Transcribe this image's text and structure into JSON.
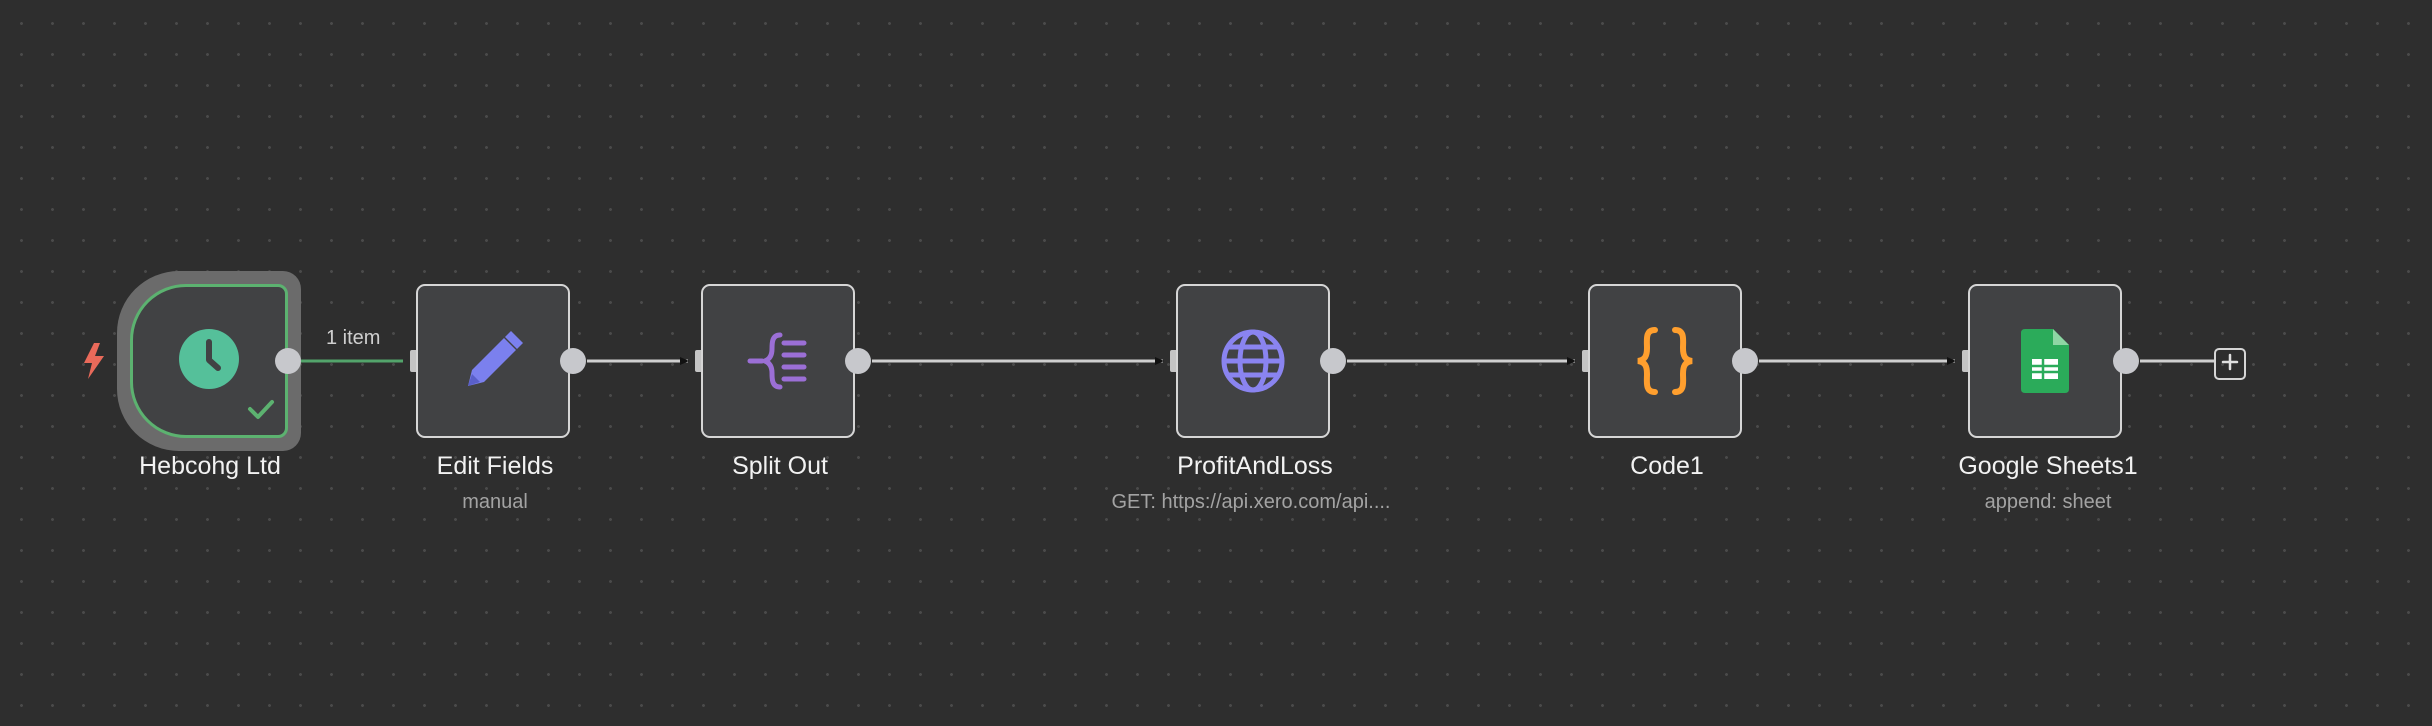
{
  "canvas": {
    "background": "#2e2e2e",
    "dot_color": "#4a4a4a"
  },
  "edge_label": "1 item",
  "nodes": [
    {
      "id": "trigger",
      "title": "Hebcohg Ltd",
      "icon": "clock-icon",
      "color": "#55c09a",
      "status": "success"
    },
    {
      "id": "edit",
      "title": "Edit Fields",
      "subtitle": "manual",
      "icon": "pencil-icon",
      "color": "#7b80ee"
    },
    {
      "id": "split",
      "title": "Split Out",
      "icon": "split-out-icon",
      "color": "#9b6fd6"
    },
    {
      "id": "http",
      "title": "ProfitAndLoss",
      "subtitle": "GET: https://api.xero.com/api....",
      "icon": "globe-icon",
      "color": "#8a84f0"
    },
    {
      "id": "code",
      "title": "Code1",
      "icon": "code-braces-icon",
      "color": "#ff9f2e"
    },
    {
      "id": "sheets",
      "title": "Google Sheets1",
      "subtitle": "append: sheet",
      "icon": "google-sheets-icon",
      "color": "#2bab5a"
    }
  ]
}
